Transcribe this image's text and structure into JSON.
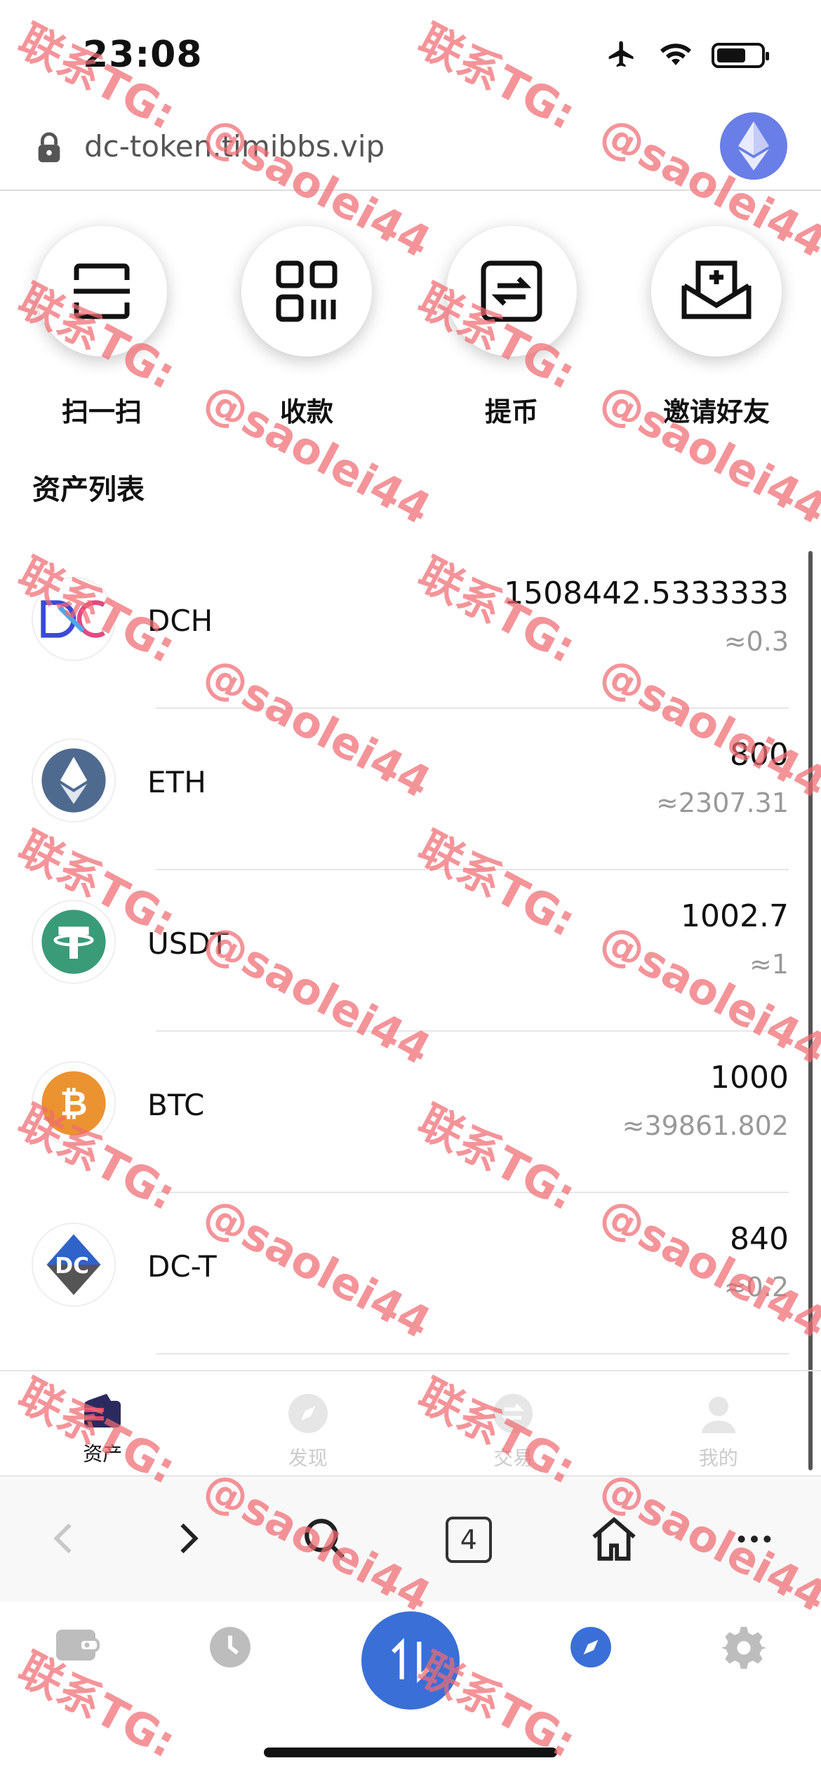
{
  "status": {
    "time": "23:08"
  },
  "browser": {
    "url": "dc-token.timibbs.vip",
    "tab_count": "4"
  },
  "quick_actions": [
    {
      "label": "扫一扫",
      "icon": "scan-icon"
    },
    {
      "label": "收款",
      "icon": "qr-code-icon"
    },
    {
      "label": "提币",
      "icon": "transfer-icon"
    },
    {
      "label": "邀请好友",
      "icon": "invite-mail-icon"
    }
  ],
  "asset_list": {
    "title": "资产列表",
    "items": [
      {
        "symbol": "DCH",
        "amount": "1508442.5333333",
        "value": "≈0.3",
        "icon": "dch-logo"
      },
      {
        "symbol": "ETH",
        "amount": "800",
        "value": "≈2307.31",
        "icon": "eth-logo"
      },
      {
        "symbol": "USDT",
        "amount": "1002.7",
        "value": "≈1",
        "icon": "usdt-logo"
      },
      {
        "symbol": "BTC",
        "amount": "1000",
        "value": "≈39861.802",
        "icon": "btc-logo"
      },
      {
        "symbol": "DC-T",
        "amount": "840",
        "value": "≈0.2",
        "icon": "dct-logo"
      }
    ]
  },
  "app_tabs": [
    {
      "label": "资产",
      "active": true
    },
    {
      "label": "发现",
      "active": false
    },
    {
      "label": "交易",
      "active": false
    },
    {
      "label": "我的",
      "active": false
    }
  ],
  "watermark": {
    "line1": "联系TG:",
    "line2": "@saolei44"
  },
  "colors": {
    "accent": "#3a6fd8",
    "watermark": "#f06b72",
    "eth_avatar": "#6a7ee8"
  }
}
